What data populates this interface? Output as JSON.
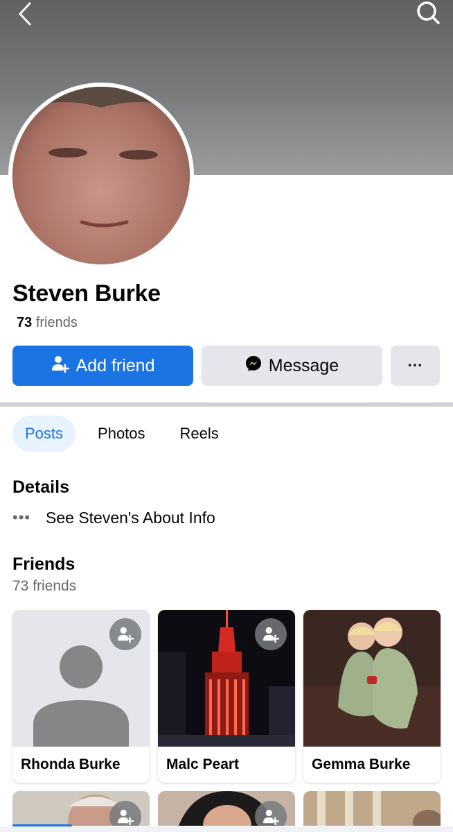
{
  "profile": {
    "name": "Steven Burke",
    "friends_count": "73",
    "friends_word": "friends"
  },
  "actions": {
    "add_friend": "Add friend",
    "message": "Message",
    "more": "···"
  },
  "tabs": [
    {
      "label": "Posts",
      "active": true
    },
    {
      "label": "Photos",
      "active": false
    },
    {
      "label": "Reels",
      "active": false
    }
  ],
  "details": {
    "title": "Details",
    "about": "See Steven's About Info"
  },
  "friends": {
    "title": "Friends",
    "count_label": "73 friends",
    "items": [
      {
        "name": "Rhonda Burke"
      },
      {
        "name": "Malc Peart"
      },
      {
        "name": "Gemma Burke"
      }
    ]
  },
  "colors": {
    "accent": "#1b74e4",
    "tab_active_bg": "#e7f3ff",
    "button_gray": "#e4e6eb"
  }
}
